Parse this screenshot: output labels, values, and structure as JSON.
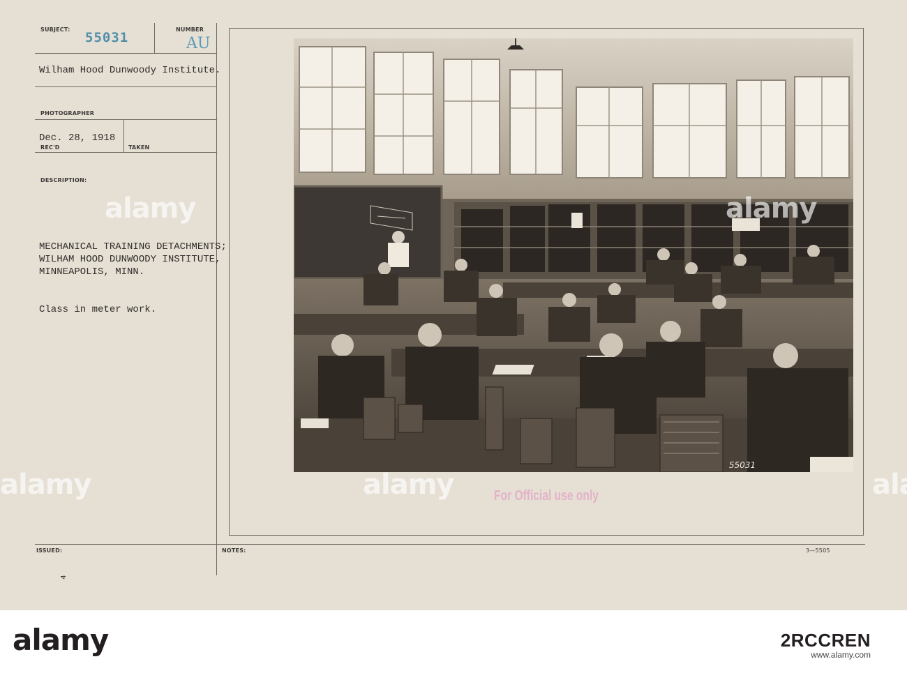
{
  "record_card": {
    "labels": {
      "subject": "SUBJECT:",
      "number": "NUMBER",
      "photographer": "PHOTOGRAPHER",
      "recd": "REC'D",
      "taken": "TAKEN",
      "description": "DESCRIPTION:",
      "issued": "ISSUED:",
      "notes": "NOTES:"
    },
    "subject_number": "55031",
    "number_code": "AU",
    "photographer": "Wilham Hood Dunwoody Institute.",
    "date_received": "Dec. 28, 1918",
    "description_lines": [
      "MECHANICAL TRAINING DETACHMENTS;",
      "WILHAM HOOD DUNWOODY INSTITUTE,",
      "MINNEAPOLIS, MINN."
    ],
    "caption": "Class in meter work.",
    "photo_number": "55031",
    "official_stamp": "For Official use only",
    "form_number": "3—5505",
    "corner_mark": "4"
  },
  "watermark": {
    "text": "alamy"
  },
  "banner": {
    "logo": "alamy",
    "image_id": "2RCCREN",
    "url": "www.alamy.com"
  },
  "colors": {
    "card": "#e6dfd4",
    "stamp_blue": "#4f8fa9",
    "official_pink": "#e3b2c9"
  }
}
